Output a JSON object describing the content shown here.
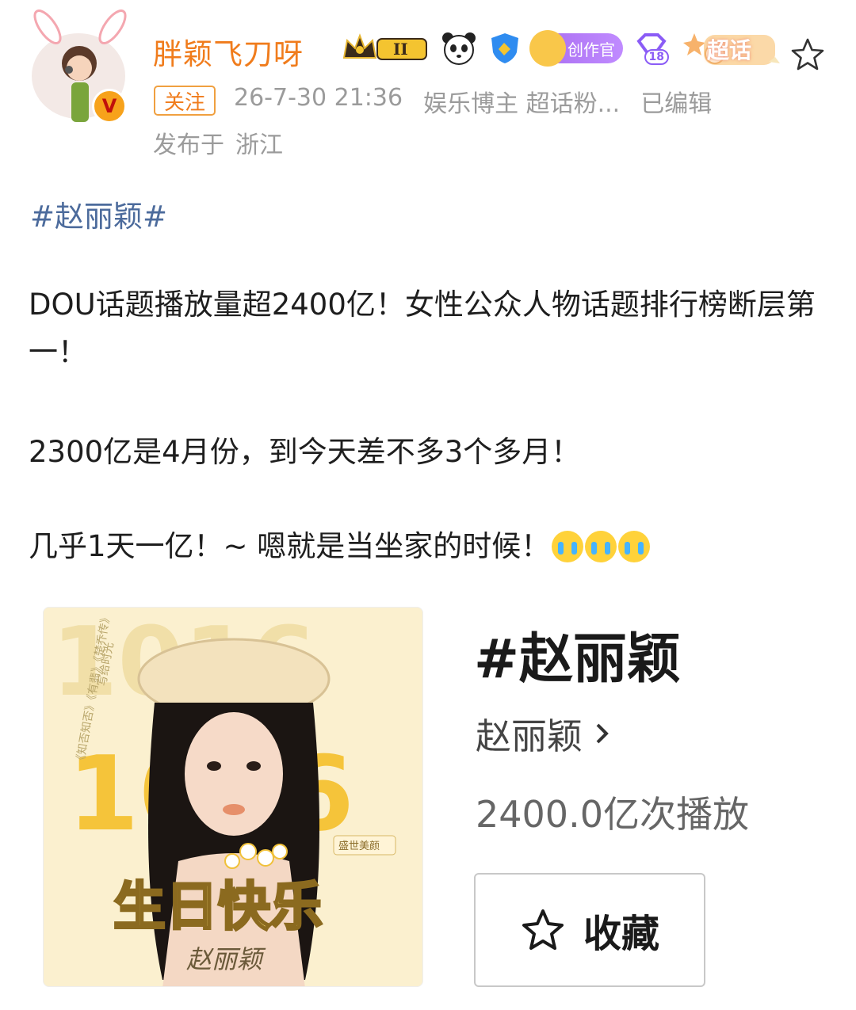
{
  "post": {
    "username": "胖颖飞刀呀",
    "follow_label": "关注",
    "timestamp": "26-7-30 21:36",
    "category": "娱乐博主 超话粉...",
    "edited": "已编辑",
    "location_prefix": "发布于",
    "location": "浙江",
    "badges": {
      "crown_level": "II",
      "creator_label": "创作官",
      "level_number": "18",
      "chaohua_label": "超话"
    },
    "topic_tag": "#赵丽颖#",
    "paragraph_1": "DOU话题播放量超2400亿！女性公众人物话题排行榜断层第一！",
    "paragraph_2": "2300亿是4月份，到今天差不多3个多月！",
    "paragraph_3": "几乎1天一亿！~ 嗯就是当坐家的时候！"
  },
  "card": {
    "title": "#赵丽颖",
    "subtitle": "赵丽颖",
    "plays": "2400.0亿次播放",
    "collect_label": "收藏",
    "image_texts": {
      "numbers": "1016",
      "works": "《知否知否》《有翡》《楚乔传》",
      "poem": "写给时光",
      "badge": "盛世美颜",
      "birthday": "生日快乐",
      "signature": "赵丽颖"
    }
  },
  "colors": {
    "username": "#f07c1c",
    "topic": "#4c6b9c",
    "meta": "#9b9b9b",
    "creator_badge": "#a86cf0"
  }
}
